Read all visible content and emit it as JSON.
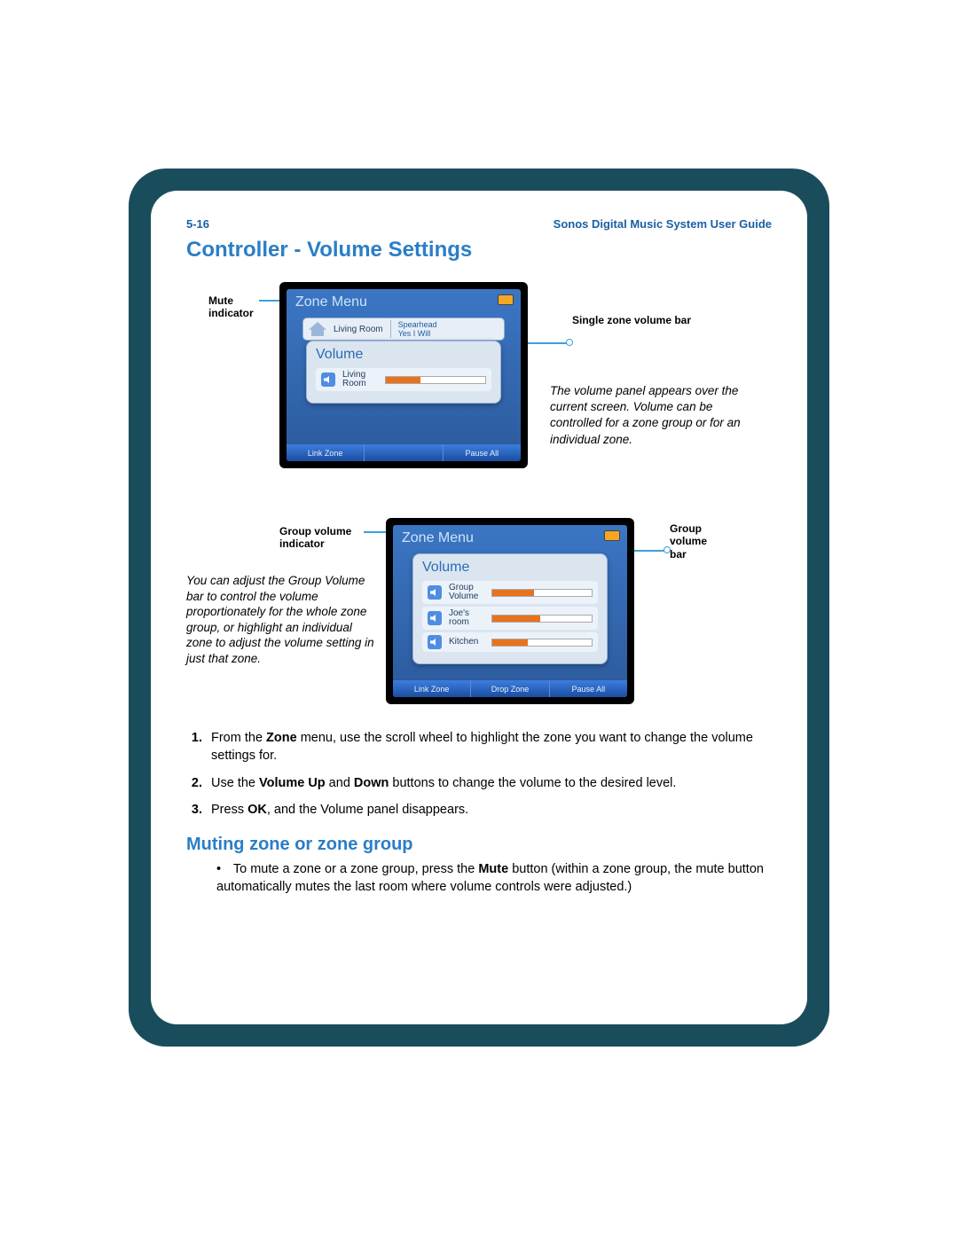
{
  "header": {
    "page_num": "5-16",
    "doc_title": "Sonos Digital Music System User Guide"
  },
  "section1": {
    "title": "Controller - Volume Settings"
  },
  "labels": {
    "mute": "Mute indicator",
    "single_bar": "Single zone volume bar",
    "group_ind": "Group volume indicator",
    "group_bar": "Group volume bar"
  },
  "screen1": {
    "title": "Zone Menu",
    "card_room": "Living Room",
    "card_track": "Spearhead",
    "card_track2": "Yes I Will",
    "popup_title": "Volume",
    "row1": "Living Room",
    "bb": [
      "Link Zone",
      "",
      "Pause All"
    ]
  },
  "screen2": {
    "title": "Zone Menu",
    "popup_title": "Volume",
    "rows": [
      "Group Volume",
      "Joe's room",
      "Kitchen"
    ],
    "bb": [
      "Link Zone",
      "Drop Zone",
      "Pause All"
    ]
  },
  "caption1": "The volume panel appears over the current screen. Volume can be controlled for a zone group or for an individual zone.",
  "caption2": "You can adjust the Group Volume bar to control the volume proportionately for the whole zone group, or highlight an individual zone to adjust the volume setting in just that zone.",
  "steps": {
    "s1a": "From the ",
    "s1_b1": "Zone",
    "s1b": " menu, use the scroll wheel to highlight the zone you want to change the volume settings for.",
    "s2a": "Use the ",
    "s2_b1": "Volume Up",
    "s2b": " and ",
    "s2_b2": "Down",
    "s2c": " buttons to change the volume to the desired level.",
    "s3a": "Press ",
    "s3_b1": "OK",
    "s3b": ", and the Volume panel disappears."
  },
  "section2": {
    "title": "Muting zone or zone group"
  },
  "mute_bullet": {
    "a": "To mute a zone or a zone group, press the ",
    "b1": "Mute",
    "b": " button (within a zone group, the mute button automatically mutes the last room where volume controls were adjusted.)"
  }
}
